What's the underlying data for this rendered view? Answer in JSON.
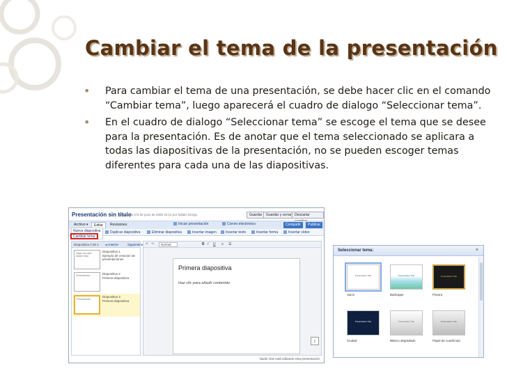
{
  "slide": {
    "title": "Cambiar el tema de la presentación",
    "bullets": [
      "Para cambiar el tema de una presentación, se debe hacer clic en el comando “Cambiar tema”, luego aparecerá el cuadro de dialogo “Seleccionar tema”.",
      "En el cuadro de dialogo “Seleccionar tema” se escoge el tema que se desee para la presentación. Es de anotar que el tema seleccionado se aplicara a todas las diapositivas de la presentación, no se pueden escoger temas diferentes para cada una de las diapositivas."
    ],
    "colors": {
      "title": "#5a3416",
      "bullet_mark": "#a48a6a",
      "highlight": "#d32020"
    }
  },
  "editor": {
    "title": "Presentación sin título",
    "saved": "Guardado el 8 de junio de 2008 10:12 por hidalio lizrego",
    "buttons": [
      "Guardar",
      "Guardar y cerrar",
      "Descartar cambios"
    ],
    "share_buttons": [
      "Compartir",
      "Publicar"
    ],
    "tabs": [
      "Archivo ▾",
      "Editar",
      "Revisiones"
    ],
    "toolbar": [
      "Iniciar presentación",
      "Correo electrónico"
    ],
    "dropdown": [
      "Nueva diapositiva",
      "Cambiar tema"
    ],
    "actions": [
      "Duplicar diapositiva",
      "Eliminar diapositiva",
      "Insertar imagen",
      "Insertar texto",
      "Insertar forma",
      "Insertar vídeo"
    ],
    "format_font": "Normal",
    "slides_header": "Diapositiva 2 de 2",
    "prev_label": "◂ Anterior",
    "next_label": "Siguiente ▸",
    "slides": [
      {
        "thumb": "Haga clic para añadir título",
        "label": "Diapositiva 1",
        "caption": "Ejemplo de creacion de presentaciones"
      },
      {
        "thumb": "Presentación",
        "label": "Diapositiva 2",
        "caption": "Primera diapositiva"
      },
      {
        "thumb": "Presentación",
        "label": "Diapositiva 3",
        "caption": "Primera diapositiva"
      }
    ],
    "canvas_title": "Primera diapositiva",
    "canvas_subtitle": "Haz clic para añadir contenido",
    "status": "Nadie más está editando esta presentación"
  },
  "theme_dialog": {
    "title": "Seleccionar tema:",
    "close_label": "×",
    "themes": [
      {
        "name": "Vacío",
        "thumb_text": "Presentation Title",
        "bg": "#ffffff",
        "text_color": "#555555"
      },
      {
        "name": "Barboppe",
        "thumb_text": "Presentation Title",
        "bg": "#bfe6ee",
        "text_color": "#336677"
      },
      {
        "name": "Pizarra",
        "thumb_text": "Presentation Title",
        "bg": "#1a1a1a",
        "text_color": "#e0c060"
      },
      {
        "name": "Ciudad",
        "thumb_text": "Presentation Title",
        "bg": "#0f1f3f",
        "text_color": "#ffffff"
      },
      {
        "name": "Blanco degradado",
        "thumb_text": "Presentation Title",
        "bg": "#e8e8e8",
        "text_color": "#666666"
      },
      {
        "name": "Papel de cuadrícula",
        "thumb_text": "Presentation Title",
        "bg": "#cfcfcf",
        "text_color": "#555555"
      }
    ]
  }
}
